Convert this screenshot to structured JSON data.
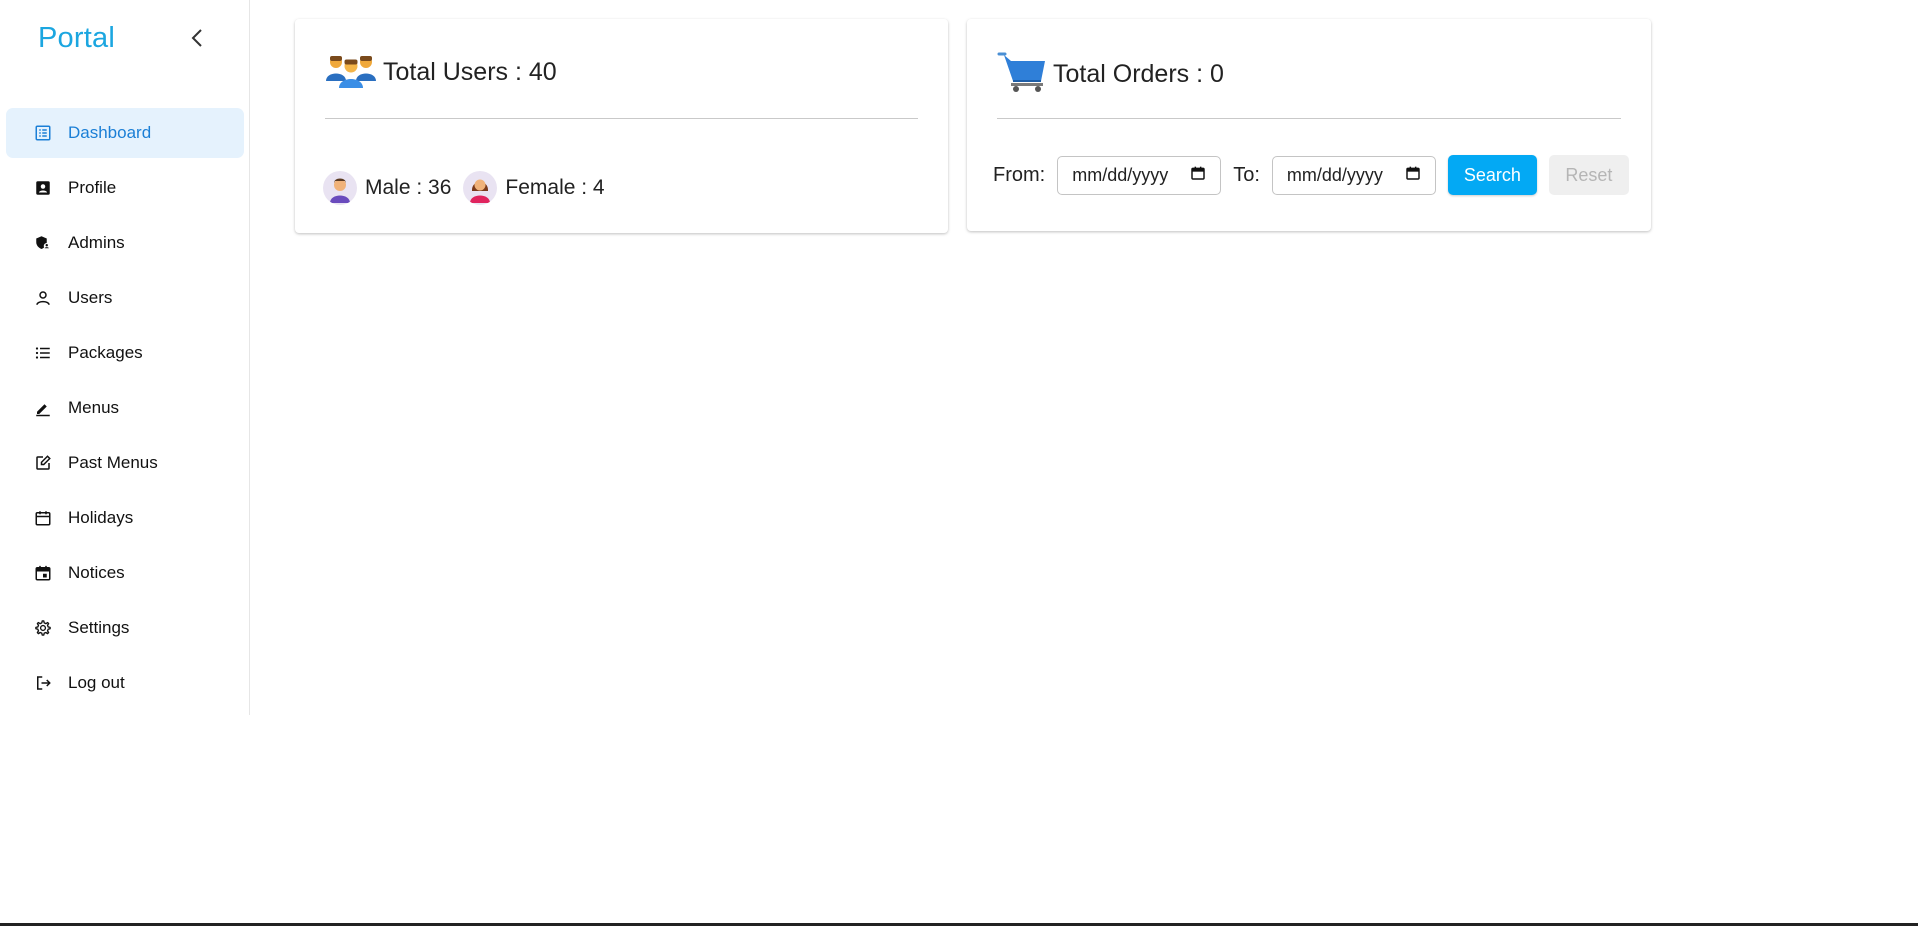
{
  "brand": "Portal",
  "colors": {
    "brand": "#1ba6e0",
    "active_bg": "#e5f2fd",
    "active_text": "#1b7fd6",
    "primary_button": "#03a9f4"
  },
  "sidebar": {
    "items": [
      {
        "label": "Dashboard",
        "icon": "dashboard-icon",
        "active": true
      },
      {
        "label": "Profile",
        "icon": "profile-card-icon"
      },
      {
        "label": "Admins",
        "icon": "admin-shield-icon"
      },
      {
        "label": "Users",
        "icon": "user-icon"
      },
      {
        "label": "Packages",
        "icon": "list-icon"
      },
      {
        "label": "Menus",
        "icon": "pen-icon"
      },
      {
        "label": "Past Menus",
        "icon": "edit-square-icon"
      },
      {
        "label": "Holidays",
        "icon": "calendar-icon"
      },
      {
        "label": "Notices",
        "icon": "event-icon"
      },
      {
        "label": "Settings",
        "icon": "gear-icon"
      },
      {
        "label": "Log out",
        "icon": "logout-icon"
      }
    ]
  },
  "users_card": {
    "title": "Total Users : 40",
    "male_label": "Male : 36",
    "female_label": "Female : 4"
  },
  "orders_card": {
    "title": "Total Orders : 0",
    "from_label": "From:",
    "to_label": "To:",
    "from_placeholder": "mm/dd/yyyy",
    "to_placeholder": "mm/dd/yyyy",
    "search_label": "Search",
    "reset_label": "Reset"
  }
}
